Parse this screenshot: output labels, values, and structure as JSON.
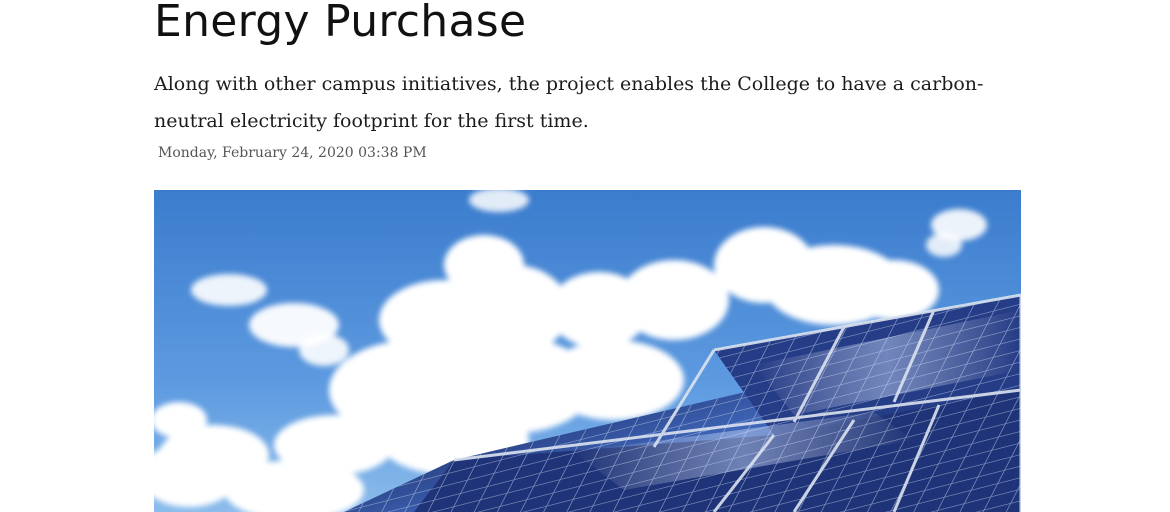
{
  "article": {
    "headline": "Energy Purchase",
    "dek": "Along with other campus initiatives, the project enables the College to have a carbon-neutral electricity footprint for the first time.",
    "dateline": "Monday, February 24, 2020 03:38 PM",
    "hero_image": {
      "subject": "solar-panels-under-blue-sky-with-clouds"
    }
  },
  "colors": {
    "sky_top": "#3d7fcf",
    "sky_bottom": "#7fb3e6",
    "cloud": "#ffffff",
    "panel_dark": "#1c2f66",
    "panel_light": "#4f6fb8",
    "frame": "#d7dee8"
  }
}
